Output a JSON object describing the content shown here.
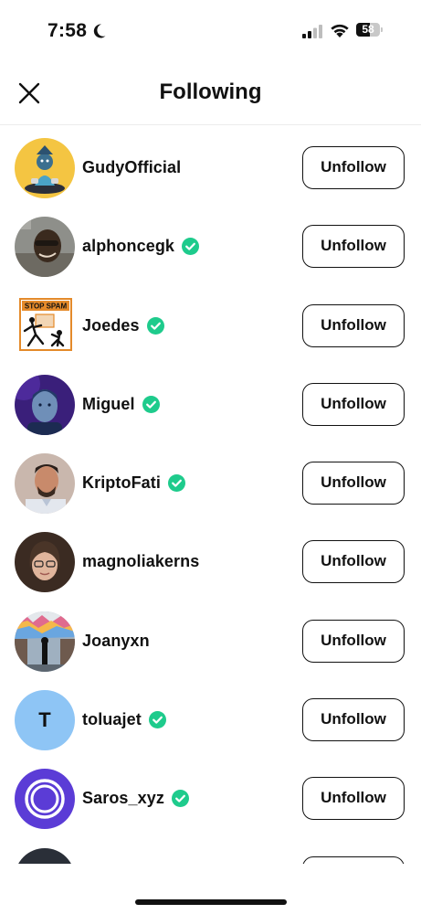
{
  "status_bar": {
    "time": "7:58",
    "battery": "58",
    "battery_level": 0.58
  },
  "header": {
    "title": "Following",
    "close_icon": "close-icon"
  },
  "colors": {
    "verified": "#1ecb8c",
    "button_border": "#111111"
  },
  "following": [
    {
      "username": "GudyOfficial",
      "verified": false,
      "avatar": "gudy",
      "action": "Unfollow"
    },
    {
      "username": "alphoncegk",
      "verified": true,
      "avatar": "alphonce",
      "action": "Unfollow"
    },
    {
      "username": "Joedes",
      "verified": true,
      "avatar": "stopspam",
      "avatar_text": "STOP SPAM",
      "action": "Unfollow"
    },
    {
      "username": "Miguel",
      "verified": true,
      "avatar": "miguel",
      "action": "Unfollow"
    },
    {
      "username": "KriptoFati",
      "verified": true,
      "avatar": "kripto",
      "action": "Unfollow"
    },
    {
      "username": "magnoliakerns",
      "verified": false,
      "avatar": "magnolia",
      "action": "Unfollow"
    },
    {
      "username": "Joanyxn",
      "verified": false,
      "avatar": "joanyxn",
      "action": "Unfollow"
    },
    {
      "username": "toluajet",
      "verified": true,
      "avatar": "letter",
      "avatar_letter": "T",
      "action": "Unfollow"
    },
    {
      "username": "Saros_xyz",
      "verified": true,
      "avatar": "saros",
      "action": "Unfollow"
    },
    {
      "username": "",
      "verified": false,
      "avatar": "partial",
      "action": ""
    }
  ]
}
